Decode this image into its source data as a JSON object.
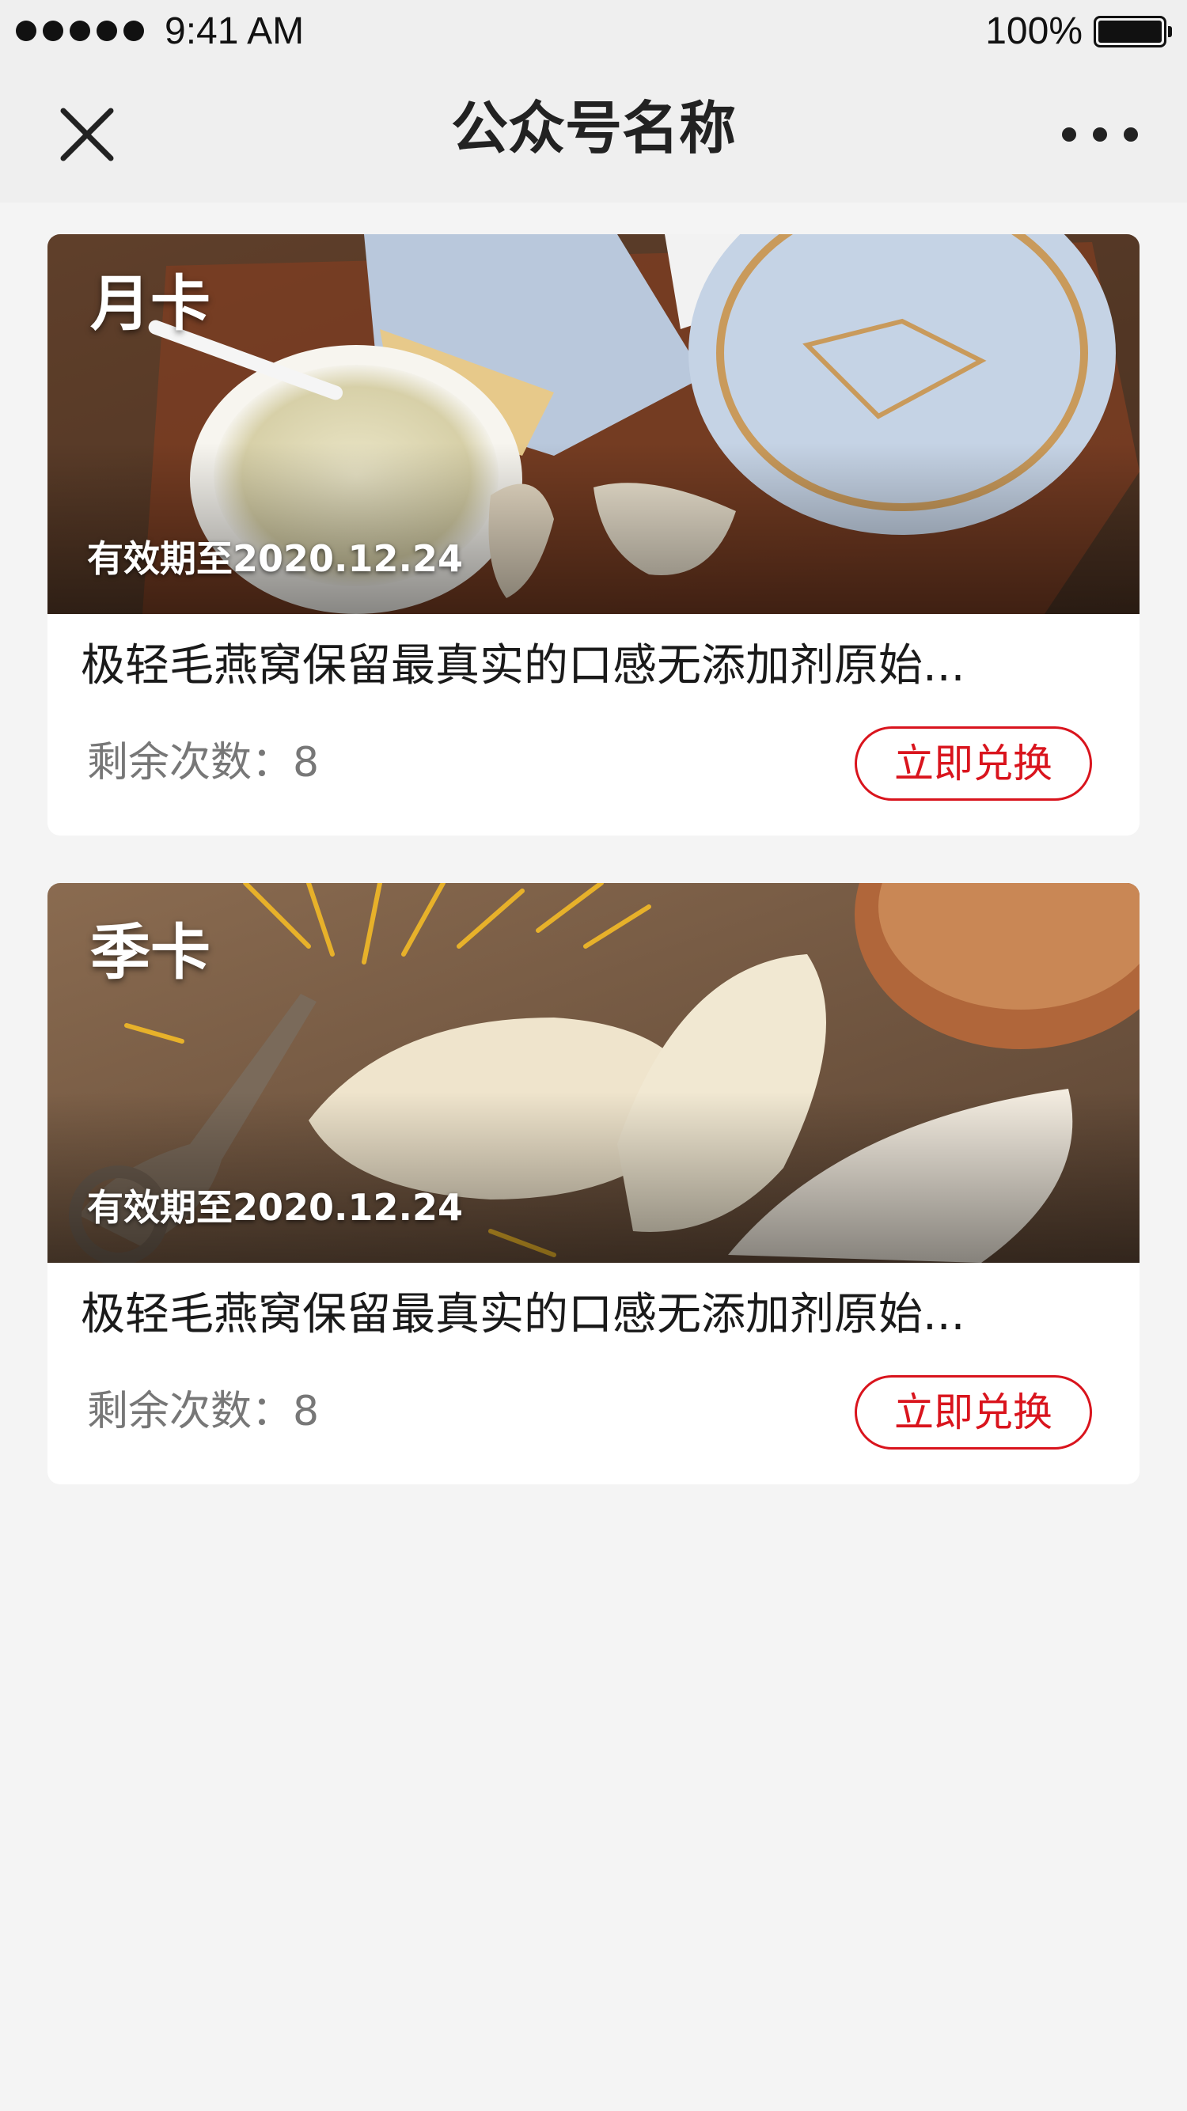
{
  "status_bar": {
    "time": "9:41 AM",
    "battery": "100%",
    "battery_level": 1.0,
    "signal_icon": "signal-dots-icon",
    "battery_icon": "battery-icon"
  },
  "nav": {
    "title": "公众号名称",
    "close_icon": "close-icon",
    "more_icon": "more-icon"
  },
  "cards": [
    {
      "type": "月卡",
      "expiry": "有效期至2020.12.24",
      "description": "极轻毛燕窝保留最真实的口感无添加剂原始...",
      "remaining_label": "剩余次数：",
      "remaining_count": "8",
      "button": "立即兑换"
    },
    {
      "type": "季卡",
      "expiry": "有效期至2020.12.24",
      "description": "极轻毛燕窝保留最真实的口感无添加剂原始...",
      "remaining_label": "剩余次数：",
      "remaining_count": "8",
      "button": "立即兑换"
    }
  ],
  "colors": {
    "accent": "#d9141d",
    "background": "#f4f4f4",
    "card": "#ffffff"
  }
}
